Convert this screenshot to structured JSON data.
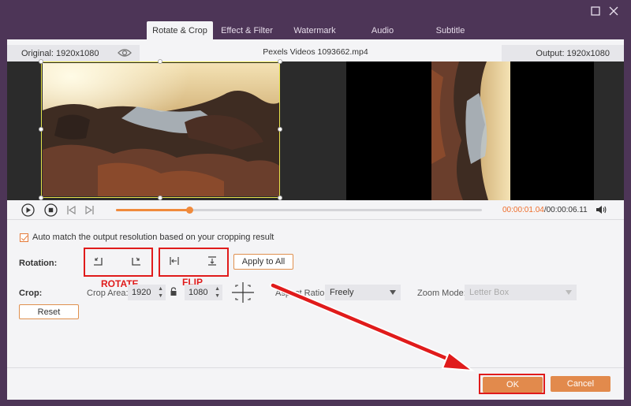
{
  "window": {
    "restore_icon": "restore-icon",
    "close_icon": "close-icon"
  },
  "tabs": [
    {
      "label": "Rotate & Crop",
      "active": true
    },
    {
      "label": "Effect & Filter",
      "active": false
    },
    {
      "label": "Watermark",
      "active": false
    },
    {
      "label": "Audio",
      "active": false
    },
    {
      "label": "Subtitle",
      "active": false
    }
  ],
  "info": {
    "original": "Original: 1920x1080",
    "filename": "Pexels Videos 1093662.mp4",
    "output": "Output: 1920x1080"
  },
  "player": {
    "current_time": "00:00:01.04",
    "total_time": "/00:00:06.11",
    "progress": 0.2
  },
  "options": {
    "auto_match_label": "Auto match the output resolution based on your cropping result",
    "auto_match_checked": true
  },
  "rotation": {
    "label": "Rotation:",
    "apply_all": "Apply to All",
    "rotate_annotation": "ROTATE",
    "flip_annotation": "FLIP"
  },
  "crop": {
    "label": "Crop:",
    "area_label": "Crop Area:",
    "width": "1920",
    "height": "1080",
    "aspect_label": "Aspect Ratio:",
    "aspect_value": "Freely",
    "zoom_label": "Zoom Mode:",
    "zoom_value": "Letter Box",
    "reset": "Reset"
  },
  "footer": {
    "ok": "OK",
    "cancel": "Cancel"
  },
  "colors": {
    "accent": "#e28a4c",
    "annotation": "#e01b1b",
    "crop_frame": "#e8e24a"
  }
}
